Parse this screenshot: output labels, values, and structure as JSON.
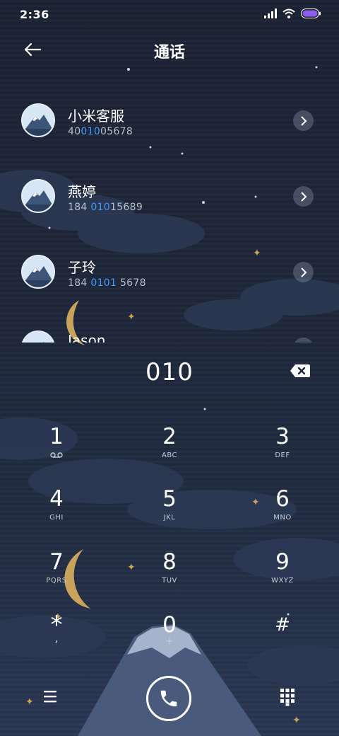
{
  "status_bar": {
    "time": "2:36",
    "icons": [
      "signal-icon",
      "wifi-icon",
      "battery-icon"
    ]
  },
  "header": {
    "title": "通话",
    "back_icon": "arrow-left-icon"
  },
  "contacts": [
    {
      "name": "小米客服",
      "number_parts": [
        "40",
        "010",
        "05678"
      ]
    },
    {
      "name": "燕婷",
      "number_parts": [
        "184 ",
        "010",
        "15689"
      ]
    },
    {
      "name": "子玲",
      "number_parts": [
        "184 ",
        "0101",
        " 5678"
      ]
    },
    {
      "name": "Jason",
      "number_parts": [
        "",
        "",
        ""
      ]
    }
  ],
  "dialer": {
    "input": "010",
    "keys": [
      {
        "digit": "1",
        "sub": "voicemail-icon"
      },
      {
        "digit": "2",
        "sub": "ABC"
      },
      {
        "digit": "3",
        "sub": "DEF"
      },
      {
        "digit": "4",
        "sub": "GHI"
      },
      {
        "digit": "5",
        "sub": "JKL"
      },
      {
        "digit": "6",
        "sub": "MNO"
      },
      {
        "digit": "7",
        "sub": "PQRS"
      },
      {
        "digit": "8",
        "sub": "TUV"
      },
      {
        "digit": "9",
        "sub": "WXYZ"
      },
      {
        "digit": "*",
        "sub": ","
      },
      {
        "digit": "0",
        "sub": "+"
      },
      {
        "digit": "#",
        "sub": ""
      }
    ]
  },
  "colors": {
    "highlight": "#3f9bff",
    "background": "#1e2739",
    "moon": "#c9a25c"
  }
}
